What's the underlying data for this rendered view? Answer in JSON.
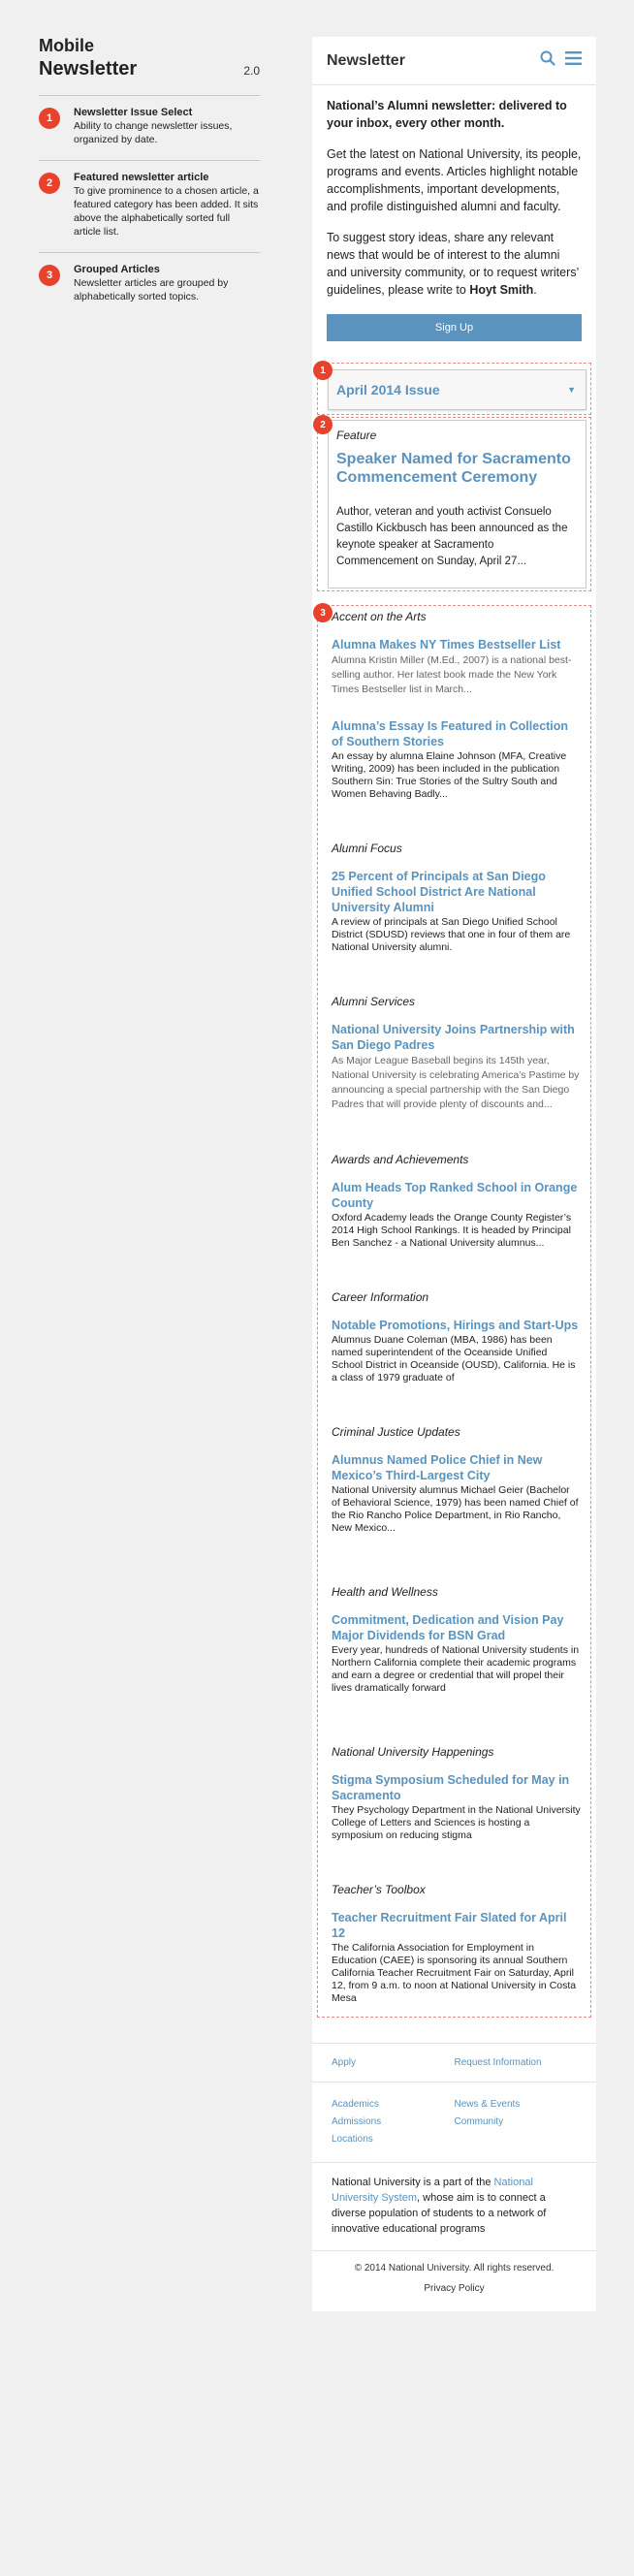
{
  "annotations": {
    "title_line1": "Mobile",
    "title_line2": "Newsletter",
    "version": "2.0",
    "notes": [
      {
        "num": "1",
        "title": "Newsletter Issue Select",
        "desc": "Ability to change newsletter issues, organized by date."
      },
      {
        "num": "2",
        "title": "Featured newsletter article",
        "desc": "To give prominence to a chosen article, a featured category has been added. It sits above the alphabetically sorted full article list."
      },
      {
        "num": "3",
        "title": "Grouped Articles",
        "desc": "Newsletter articles are grouped by alphabetically sorted topics."
      }
    ]
  },
  "header": {
    "title": "Newsletter",
    "search_icon": "search-icon",
    "menu_icon": "hamburger-menu-icon",
    "accent": "#5a93be"
  },
  "intro": {
    "lead": "National’s Alumni newsletter: delivered to your inbox, every other month.",
    "p1": "Get the latest on National University, its people, programs and events. Articles highlight notable accomplishments, important developments, and profile distinguished alumni and faculty.",
    "p2_before": "To suggest story ideas, share any relevant news that would be of interest to the alumni and university community, or to request writers’ guidelines, please write to ",
    "p2_name": "Hoyt Smith",
    "p2_after": ".",
    "signup_label": "Sign Up"
  },
  "issue_select": {
    "badge": "1",
    "value": "April 2014 Issue"
  },
  "featured": {
    "badge": "2",
    "category": "Feature",
    "headline": "Speaker Named for Sacramento Commencement Ceremony",
    "desc": "Author, veteran and youth activist Consuelo Castillo Kickbusch has been announced as the keynote speaker at Sacramento Commencement on Sunday, April 27..."
  },
  "groups_badge": "3",
  "groups": [
    {
      "category": "Accent on the Arts",
      "articles": [
        {
          "headline": "Alumna Makes NY Times Bestseller List",
          "desc": "Alumna Kristin Miller (M.Ed., 2007) is a national best-selling author. Her latest book made the New York Times Bestseller list in March..."
        },
        {
          "headline": "Alumna’s Essay Is Featured in Collection of Southern Stories",
          "desc": "An essay by alumna Elaine Johnson (MFA, Creative Writing, 2009) has been included in the publication Southern Sin: True Stories of the Sultry South and Women Behaving Badly..."
        }
      ]
    },
    {
      "category": "Alumni Focus",
      "articles": [
        {
          "headline": "25 Percent of Principals at San Diego Unified School District Are National University Alumni",
          "desc": "A review of principals at San Diego Unified School District (SDUSD) reviews that one in four of them are National University alumni."
        }
      ]
    },
    {
      "category": "Alumni Services",
      "articles": [
        {
          "headline": "National University Joins Partnership with San Diego Padres",
          "desc": "As Major League Baseball begins its 145th year, National University is celebrating America’s Pastime by announcing a special partnership with the San Diego Padres that will provide plenty of discounts and..."
        }
      ]
    },
    {
      "category": "Awards and Achievements",
      "articles": [
        {
          "headline": "Alum Heads Top Ranked School in Orange County",
          "desc": "Oxford Academy leads the Orange County Register’s 2014 High School Rankings. It is headed by Principal Ben Sanchez - a National University alumnus..."
        }
      ]
    },
    {
      "category": "Career Information",
      "articles": [
        {
          "headline": "Notable Promotions, Hirings and Start-Ups",
          "desc": "Alumnus Duane Coleman (MBA, 1986) has been named superintendent of the Oceanside Unified School District in Oceanside (OUSD), California. He is a class of 1979 graduate of"
        }
      ]
    },
    {
      "category": "Criminal Justice Updates",
      "articles": [
        {
          "headline": "Alumnus Named Police Chief in New Mexico’s Third-Largest City",
          "desc": "National University alumnus Michael Geier (Bachelor of Behavioral Science, 1979) has been named Chief of the Rio Rancho Police Department, in Rio Rancho, New Mexico..."
        }
      ]
    },
    {
      "category": "Health and Wellness",
      "articles": [
        {
          "headline": "Commitment, Dedication and Vision Pay Major Dividends for BSN Grad",
          "desc": "Every year, hundreds of National University students in Northern California complete their academic programs and earn a degree or credential that will propel their lives dramatically forward"
        }
      ]
    },
    {
      "category": "National University Happenings",
      "articles": [
        {
          "headline": "Stigma Symposium Scheduled for May in Sacramento",
          "desc": "They Psychology Department in the National University College of Letters and Sciences is hosting a symposium on reducing stigma"
        }
      ]
    },
    {
      "category": "Teacher’s Toolbox",
      "articles": [
        {
          "headline": "Teacher Recruitment Fair Slated for April 12",
          "desc": "The California Association for Employment in Education (CAEE) is sponsoring its annual Southern California Teacher Recruitment Fair on Saturday, April 12, from 9 a.m. to noon at National University in Costa Mesa"
        }
      ]
    }
  ],
  "footer": {
    "apply": "Apply",
    "request_info": "Request Information",
    "academics": "Academics",
    "admissions": "Admissions",
    "locations": "Locations",
    "news_events": "News & Events",
    "community": "Community",
    "about_before": "National University is a part of the ",
    "about_link": "National University System",
    "about_after": ", whose aim is to connect a diverse population of students to a network of innovative educational programs",
    "copyright": "© 2014 National University. All rights reserved.",
    "privacy": "Privacy Policy"
  }
}
